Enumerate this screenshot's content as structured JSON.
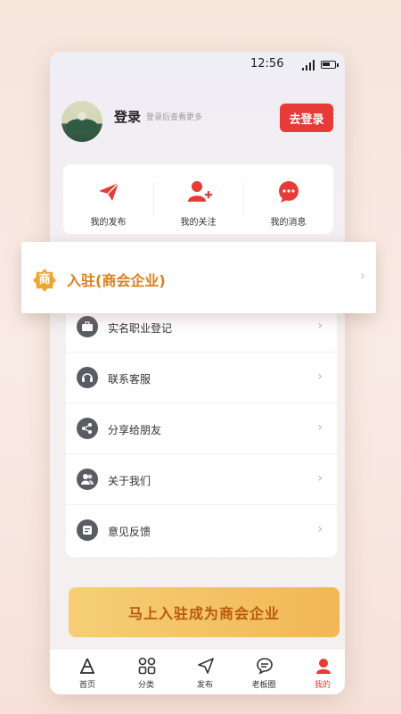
{
  "status": {
    "time": "12:56"
  },
  "header": {
    "title": "登录",
    "subtitle": "登录后查看更多",
    "login_button": "去登录"
  },
  "quick_actions": [
    {
      "label": "我的发布",
      "icon": "paper-plane-icon"
    },
    {
      "label": "我的关注",
      "icon": "user-add-icon"
    },
    {
      "label": "我的消息",
      "icon": "message-bubble-icon"
    }
  ],
  "banner": {
    "badge": "商",
    "label": "入驻(商会企业)"
  },
  "menu": [
    {
      "label": "实名职业登记",
      "icon": "briefcase-icon"
    },
    {
      "label": "联系客服",
      "icon": "headset-icon"
    },
    {
      "label": "分享给朋友",
      "icon": "share-icon"
    },
    {
      "label": "关于我们",
      "icon": "users-icon"
    },
    {
      "label": "意见反馈",
      "icon": "document-icon"
    }
  ],
  "cta": {
    "label": "马上入驻成为商会企业"
  },
  "tabbar": [
    {
      "label": "首页",
      "icon": "home-icon"
    },
    {
      "label": "分类",
      "icon": "grid-icon"
    },
    {
      "label": "发布",
      "icon": "send-icon"
    },
    {
      "label": "老板圈",
      "icon": "chat-icon"
    },
    {
      "label": "我的",
      "icon": "user-icon",
      "active": true
    }
  ],
  "colors": {
    "accent": "#e83a37",
    "gold": "#f2b755",
    "banner_text": "#e07e1c"
  }
}
